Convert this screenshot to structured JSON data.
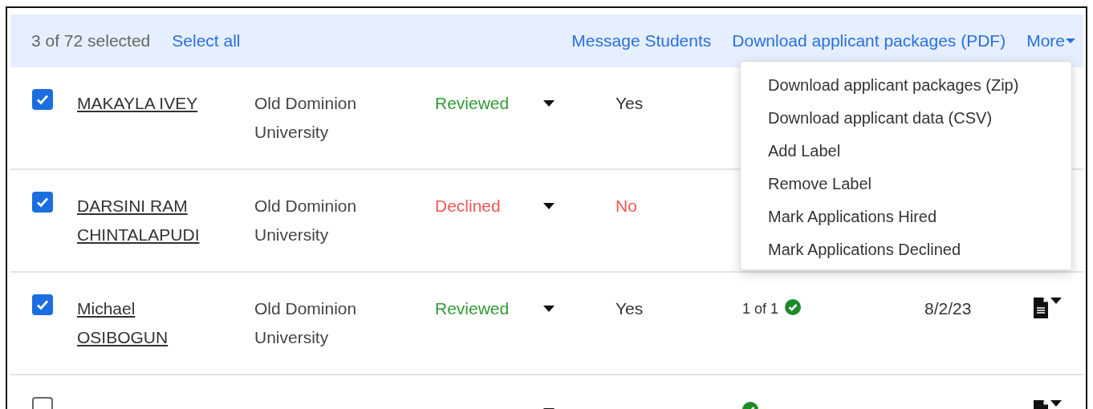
{
  "toolbar": {
    "selection_count": "3 of 72 selected",
    "select_all": "Select all",
    "actions": [
      "Message Students",
      "Download applicant packages (PDF)"
    ],
    "more": "More"
  },
  "more_menu": {
    "items": [
      "Download applicant packages (Zip)",
      "Download applicant data (CSV)",
      "Add Label",
      "Remove Label",
      "Mark Applications Hired",
      "Mark Applications Declined"
    ]
  },
  "rows": [
    {
      "checked": true,
      "name": "MAKAYLA IVEY",
      "school": "Old Dominion University",
      "status": {
        "text": "Reviewed",
        "kind": "positive"
      },
      "answer": {
        "text": "Yes",
        "kind": "neutral"
      }
    },
    {
      "checked": true,
      "name": "DARSINI RAM CHINTALAPUDI",
      "school": "Old Dominion University",
      "status": {
        "text": "Declined",
        "kind": "negative"
      },
      "answer": {
        "text": "No",
        "kind": "negative"
      }
    },
    {
      "checked": true,
      "name": "Michael OSIBOGUN",
      "school": "Old Dominion University",
      "status": {
        "text": "Reviewed",
        "kind": "positive"
      },
      "answer": {
        "text": "Yes",
        "kind": "neutral"
      },
      "documents": "1 of 1",
      "documents_complete": true,
      "date": "8/2/23"
    },
    {
      "checked": false,
      "documents_complete": true
    }
  ]
}
